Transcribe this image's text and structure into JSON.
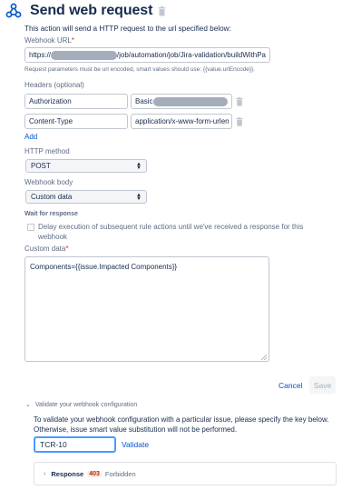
{
  "header": {
    "title": "Send web request"
  },
  "description": "This action will send a HTTP request to the url specified below:",
  "webhook_url": {
    "label": "Webhook URL",
    "prefix": "https://",
    "suffix": "/job/automation/job/Jira-validation/buildWithPa",
    "help": "Request parameters must be url encoded, smart values should use: {{value.urlEncode}}."
  },
  "headers": {
    "label": "Headers (optional)",
    "rows": [
      {
        "key": "Authorization",
        "value": "Basic "
      },
      {
        "key": "Content-Type",
        "value": "application/x-www-form-urlen"
      }
    ],
    "add_label": "Add"
  },
  "http_method": {
    "label": "HTTP method",
    "value": "POST"
  },
  "webhook_body": {
    "label": "Webhook body",
    "value": "Custom data"
  },
  "wait_for_response": {
    "label": "Wait for response",
    "checkbox_label": "Delay execution of subsequent rule actions until we've received a response for this webhook"
  },
  "custom_data": {
    "label": "Custom data",
    "value": "Components={{issue.Impacted Components}}"
  },
  "actions": {
    "cancel": "Cancel",
    "save": "Save"
  },
  "validate": {
    "heading": "Validate your webhook configuration",
    "description": "To validate your webhook configuration with a particular issue, please specify the key below. Otherwise, issue smart value substitution will not be performed.",
    "issue_key": "TCR-10",
    "button": "Validate"
  },
  "response": {
    "label": "Response",
    "code": "403",
    "status": "Forbidden"
  },
  "colors": {
    "accent": "#0052cc",
    "focus": "#4c9aff",
    "error_bg": "#ffebe6",
    "error_text": "#bf2600",
    "required": "#de350b"
  }
}
